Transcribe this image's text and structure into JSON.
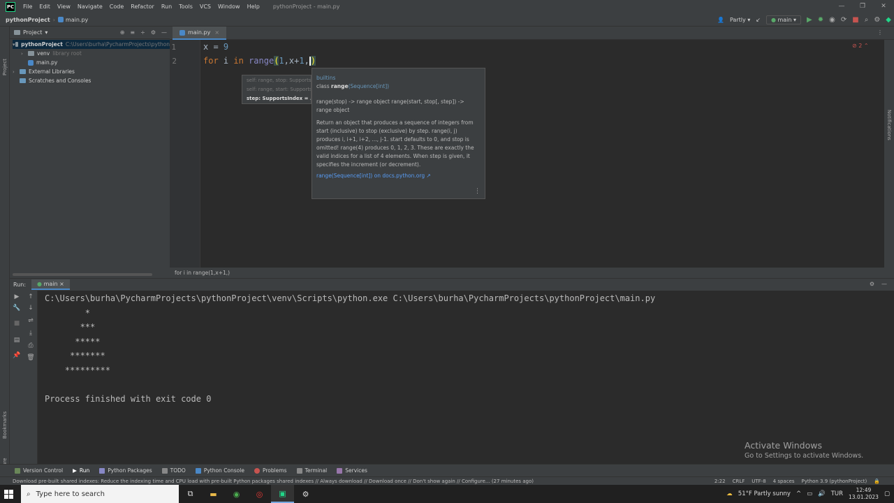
{
  "menubar": {
    "logo": "PC",
    "items": [
      "File",
      "Edit",
      "View",
      "Navigate",
      "Code",
      "Refactor",
      "Run",
      "Tools",
      "VCS",
      "Window",
      "Help"
    ],
    "window_title": "pythonProject - main.py"
  },
  "navbar": {
    "project": "pythonProject",
    "file": "main.py",
    "user": "Partly sunny",
    "run_config": "main"
  },
  "project_panel": {
    "title": "Project",
    "tree": [
      {
        "label": "pythonProject",
        "hint": "C:\\Users\\burha\\PycharmProjects\\python"
      },
      {
        "label": "venv",
        "hint": "library root"
      },
      {
        "label": "main.py",
        "hint": ""
      },
      {
        "label": "External Libraries",
        "hint": ""
      },
      {
        "label": "Scratches and Consoles",
        "hint": ""
      }
    ]
  },
  "editor": {
    "tab": "main.py",
    "line_numbers": [
      "1",
      "2"
    ],
    "error_count": "2",
    "breadcrumb": "for i in range(1,x+1,)"
  },
  "param_hint": {
    "rows": [
      "self: range, stop: SupportsIndex",
      "self: range, start: SupportsIndex",
      "step: SupportsIndex = ..."
    ]
  },
  "doc_popup": {
    "module": "builtins",
    "class_kw": "class",
    "class_name": "range",
    "class_generic": "(Sequence[int])",
    "signature": "range(stop) -> range object range(start, stop[, step]) -> range object",
    "description": "Return an object that produces a sequence of integers from start (inclusive) to stop (exclusive) by step. range(i, j) produces i, i+1, i+2, ..., j-1. start defaults to 0, and stop is omitted! range(4) produces 0, 1, 2, 3. These are exactly the valid indices for a list of 4 elements. When step is given, it specifies the increment (or decrement).",
    "link": "range(Sequence[int]) on docs.python.org ↗",
    "menu": "⋮"
  },
  "run_panel": {
    "label": "Run:",
    "tab": "main",
    "command": "C:\\Users\\burha\\PycharmProjects\\pythonProject\\venv\\Scripts\\python.exe C:\\Users\\burha\\PycharmProjects\\pythonProject\\main.py",
    "output": [
      "        *",
      "       ***",
      "      *****",
      "     *******",
      "    *********"
    ],
    "exit": "Process finished with exit code 0"
  },
  "activate": {
    "title": "Activate Windows",
    "subtitle": "Go to Settings to activate Windows."
  },
  "tool_windows": [
    "Version Control",
    "Run",
    "Python Packages",
    "TODO",
    "Python Console",
    "Problems",
    "Terminal",
    "Services"
  ],
  "statusbar": {
    "message": "Download pre-built shared indexes: Reduce the indexing time and CPU load with pre-built Python packages shared indexes // Always download // Download once // Don't show again // Configure... (27 minutes ago)",
    "position": "2:22",
    "line_sep": "CRLF",
    "encoding": "UTF-8",
    "indent": "4 spaces",
    "interpreter": "Python 3.9 (pythonProject)"
  },
  "taskbar": {
    "search_placeholder": "Type here to search",
    "weather": "51°F  Partly sunny",
    "lang": "TUR",
    "time": "12:49",
    "date": "13.01.2023"
  },
  "colors": {
    "keyword": "#cc7832",
    "number": "#6897bb",
    "background": "#2b2b2b",
    "panel": "#3c3f41",
    "accent": "#4a88c7"
  }
}
